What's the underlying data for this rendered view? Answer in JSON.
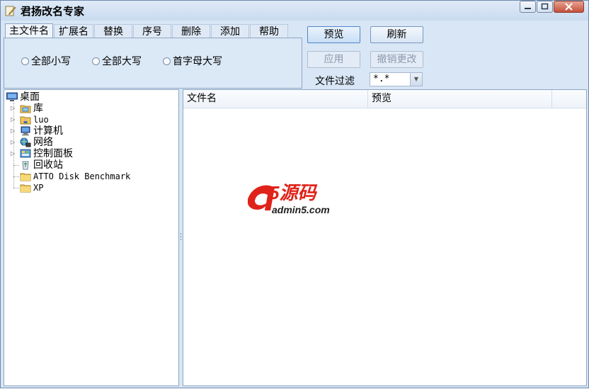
{
  "window": {
    "title": "君扬改名专家",
    "accent": "#c9dbf0"
  },
  "tabs": [
    {
      "label": "主文件名",
      "active": true
    },
    {
      "label": "扩展名"
    },
    {
      "label": "替换"
    },
    {
      "label": "序号"
    },
    {
      "label": "删除"
    },
    {
      "label": "添加"
    },
    {
      "label": "帮助"
    }
  ],
  "case_options": [
    {
      "label": "全部小写",
      "selected": false
    },
    {
      "label": "全部大写",
      "selected": false
    },
    {
      "label": "首字母大写",
      "selected": false
    }
  ],
  "buttons": {
    "preview": "预览",
    "refresh": "刷新",
    "apply": "应用",
    "undo": "撤销更改"
  },
  "filter": {
    "label": "文件过滤",
    "value": "*.*"
  },
  "tree": {
    "items": [
      {
        "label": "桌面",
        "icon": "desktop-icon"
      },
      {
        "label": "库",
        "icon": "library-icon"
      },
      {
        "label": "luo",
        "icon": "user-folder-icon"
      },
      {
        "label": "计算机",
        "icon": "computer-icon"
      },
      {
        "label": "网络",
        "icon": "network-icon"
      },
      {
        "label": "控制面板",
        "icon": "control-panel-icon"
      },
      {
        "label": "回收站",
        "icon": "recycle-bin-icon"
      },
      {
        "label": "ATTO Disk Benchmark",
        "icon": "folder-icon"
      },
      {
        "label": "XP",
        "icon": "folder-icon"
      }
    ]
  },
  "list": {
    "columns": [
      "文件名",
      "预览"
    ]
  },
  "watermark": {
    "logo_text": "a5源码",
    "url_text": "admin5.com",
    "colors": {
      "red": "#e0231a",
      "dark": "#1d1d1d"
    }
  }
}
